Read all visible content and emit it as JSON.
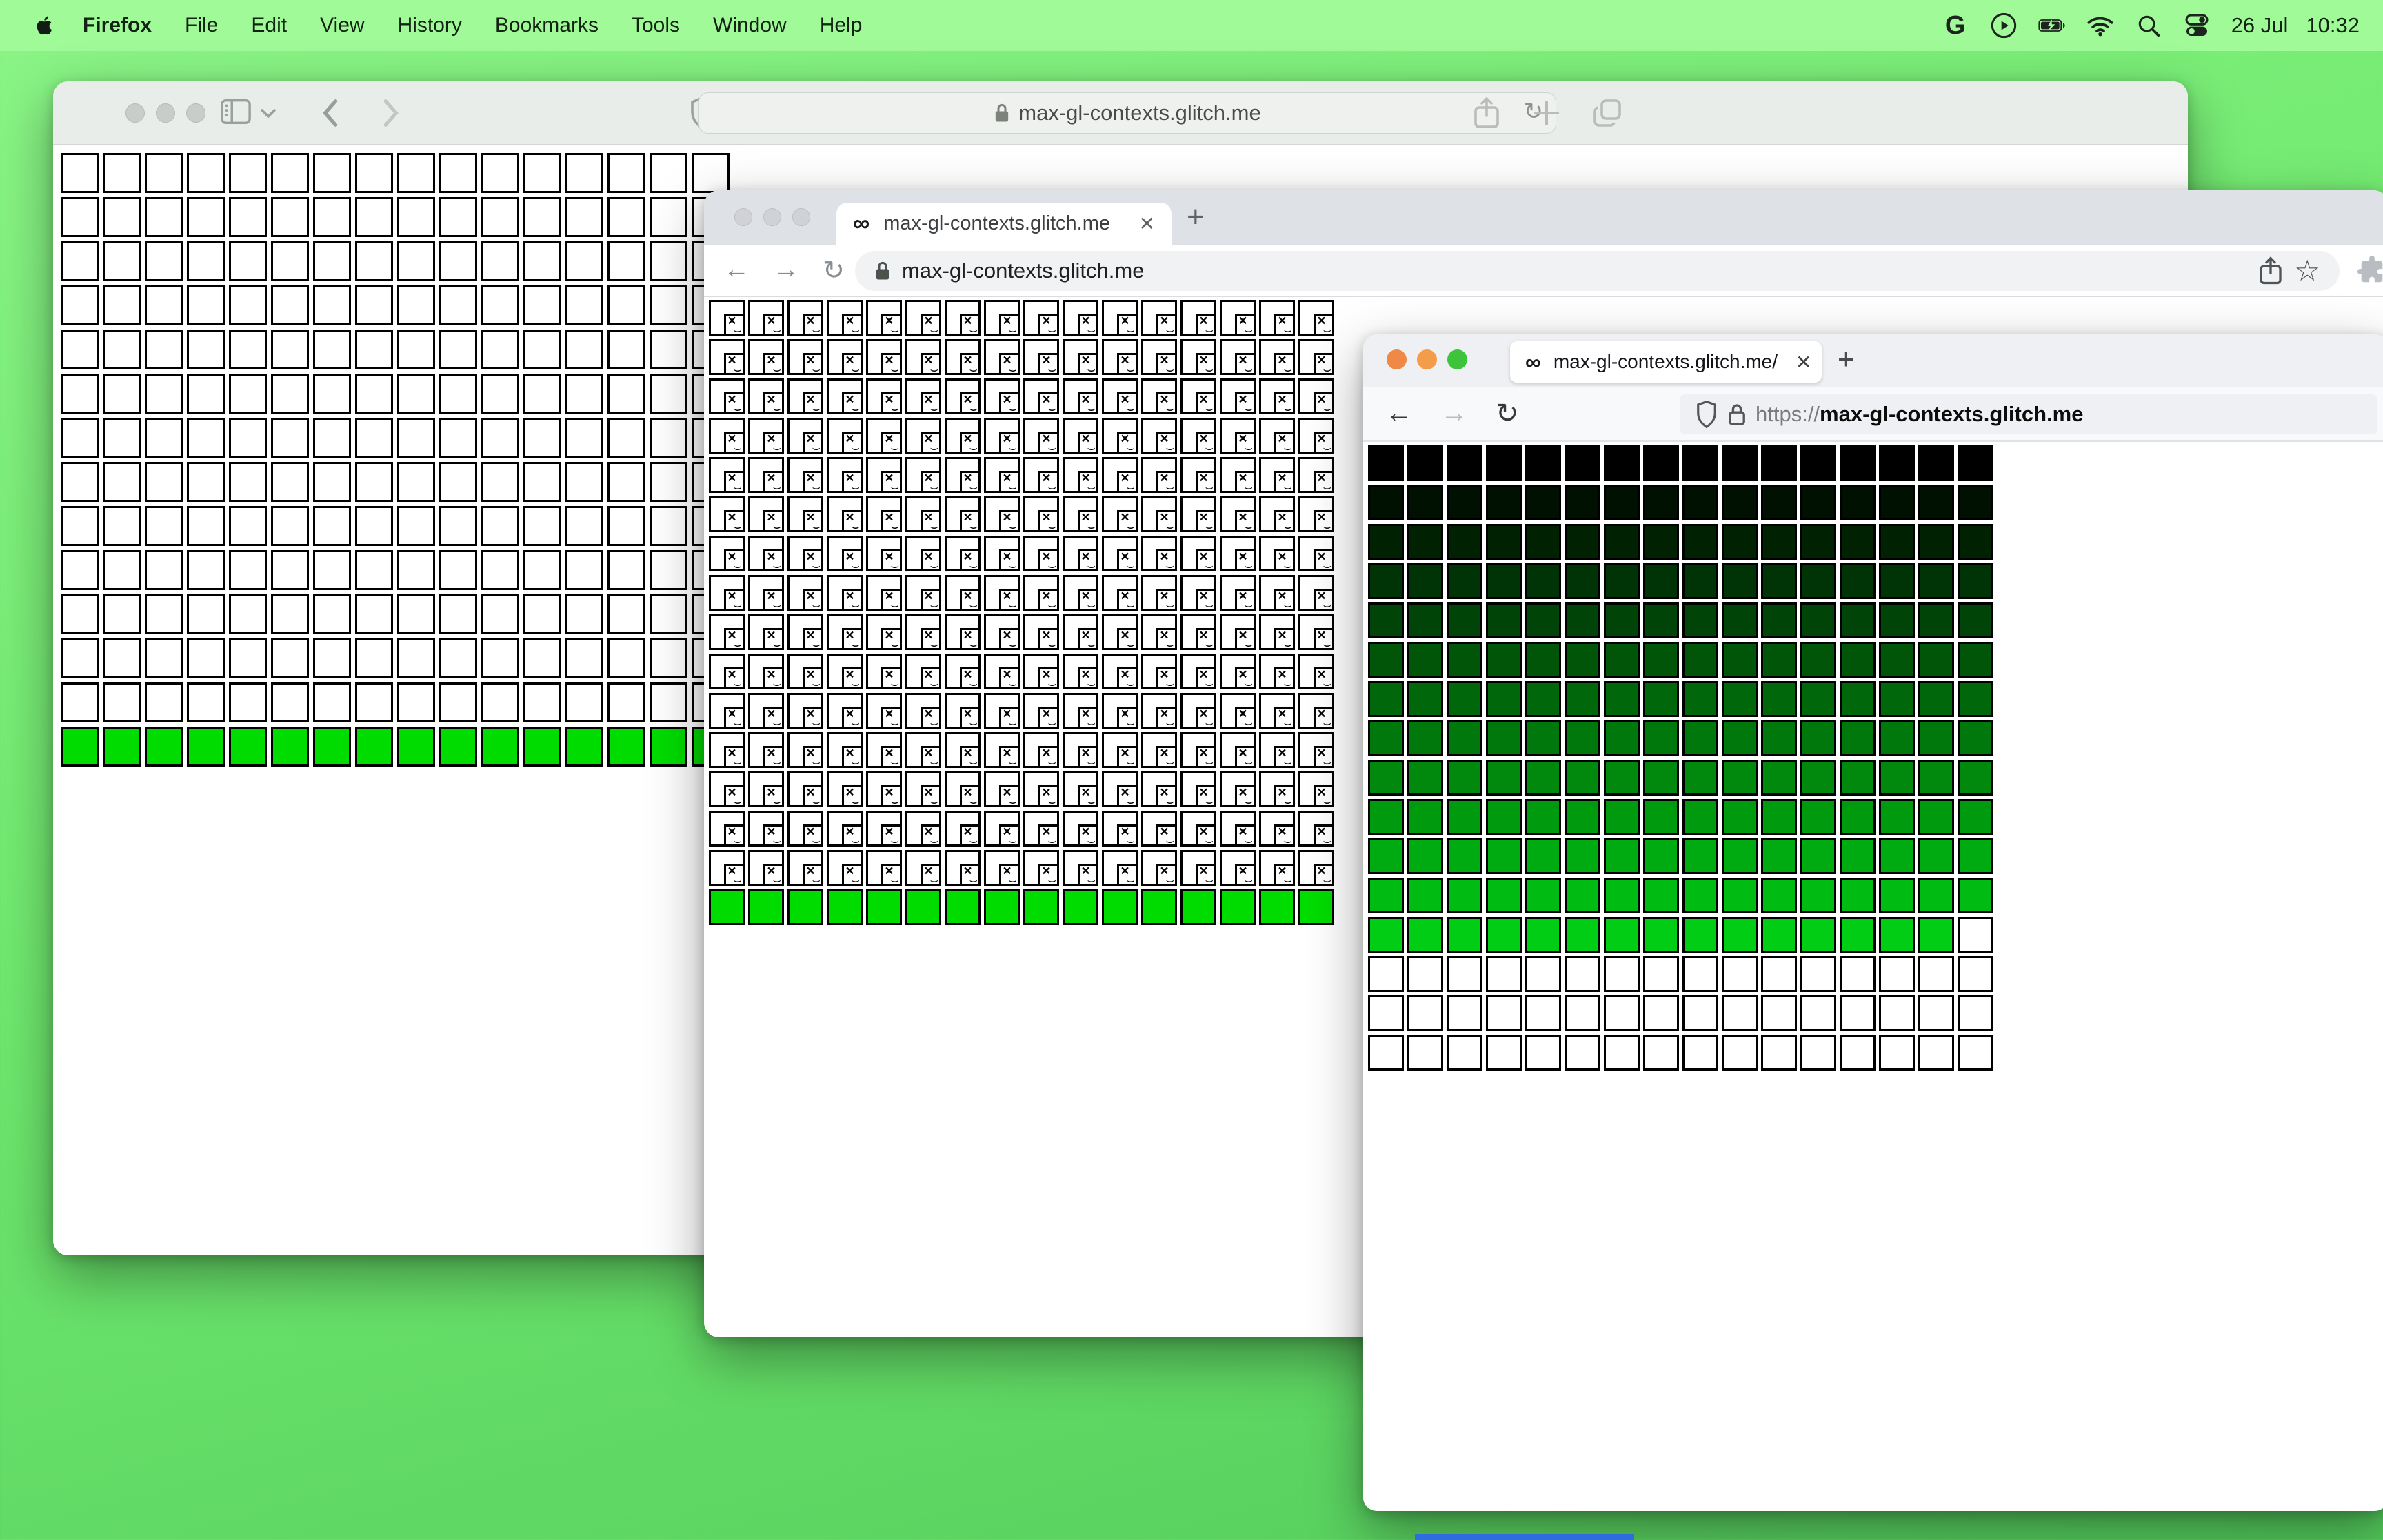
{
  "menu_bar": {
    "items": [
      "Firefox",
      "File",
      "Edit",
      "View",
      "History",
      "Bookmarks",
      "Tools",
      "Window",
      "Help"
    ],
    "status": {
      "g_label": "G",
      "date": "26 Jul",
      "time": "10:32"
    }
  },
  "glyphs": {
    "infinity": "∞",
    "close": "✕",
    "plus": "+",
    "reload": "↻",
    "back_arrow": "←",
    "forward_arrow": "→",
    "star": "☆",
    "broken_x": "×",
    "broken_wave": "⌣"
  },
  "safari": {
    "url": "max-gl-contexts.glitch.me"
  },
  "chrome": {
    "tab_title": "max-gl-contexts.glitch.me",
    "url": "max-gl-contexts.glitch.me"
  },
  "firefox": {
    "tab_title": "max-gl-contexts.glitch.me/",
    "url_scheme": "https://",
    "url_host": "max-gl-contexts.glitch.me"
  },
  "colors": {
    "context_green": "#00dc00",
    "desktop_green": "#6fe96e",
    "menubar_green": "#9ffa97"
  },
  "grids": {
    "safari": {
      "columns": 16,
      "row_colors": [
        "#ffffff",
        "#ffffff",
        "#ffffff",
        "#ffffff",
        "#ffffff",
        "#ffffff",
        "#ffffff",
        "#ffffff",
        "#ffffff",
        "#ffffff",
        "#ffffff",
        "#ffffff",
        "#ffffff",
        "#00dc00"
      ],
      "missing_cells": []
    },
    "chrome": {
      "columns": 16,
      "row_colors": [
        "broken",
        "broken",
        "broken",
        "broken",
        "broken",
        "broken",
        "broken",
        "broken",
        "broken",
        "broken",
        "broken",
        "broken",
        "broken",
        "broken",
        "broken",
        "#00dc00"
      ],
      "missing_cells": []
    },
    "firefox": {
      "columns": 16,
      "row_colors": [
        "#000000",
        "#001102",
        "#002203",
        "#003305",
        "#004407",
        "#005508",
        "#00670a",
        "#00780c",
        "#00890d",
        "#009a0f",
        "#00ab11",
        "#00bc12",
        "#00cd14",
        "#ffffff",
        "#ffffff",
        "#ffffff"
      ],
      "missing_cells": [
        {
          "row": 12,
          "col": 15,
          "color": "#ffffff"
        }
      ]
    }
  }
}
